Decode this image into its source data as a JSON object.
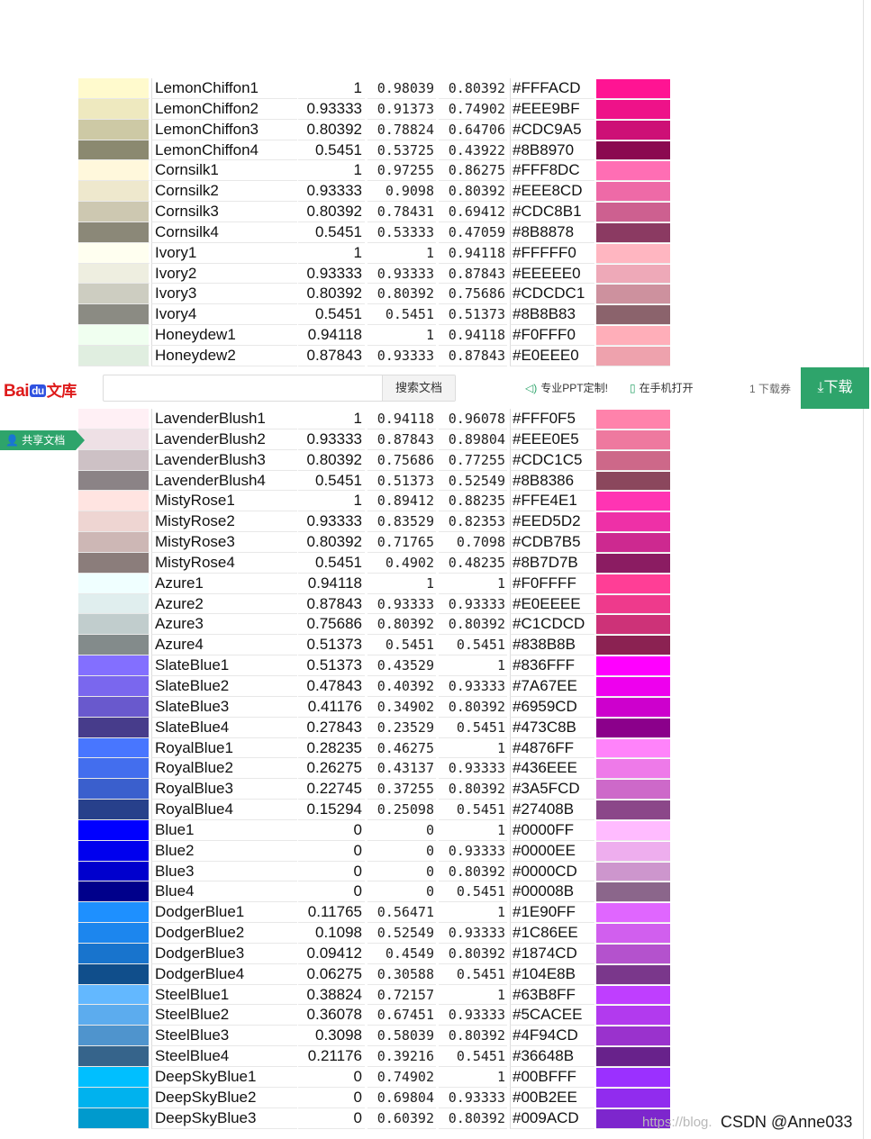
{
  "colors_top": [
    {
      "name": "LemonChiffon1",
      "r": "1",
      "g": "0.98039",
      "b": "0.80392",
      "hex": "#FFFACD",
      "swatch": "#FFFACD",
      "swatch2": "#FF1493"
    },
    {
      "name": "LemonChiffon2",
      "r": "0.93333",
      "g": "0.91373",
      "b": "0.74902",
      "hex": "#EEE9BF",
      "swatch": "#EEE9BF",
      "swatch2": "#EE1289"
    },
    {
      "name": "LemonChiffon3",
      "r": "0.80392",
      "g": "0.78824",
      "b": "0.64706",
      "hex": "#CDC9A5",
      "swatch": "#CDC9A5",
      "swatch2": "#CD1076"
    },
    {
      "name": "LemonChiffon4",
      "r": "0.5451",
      "g": "0.53725",
      "b": "0.43922",
      "hex": "#8B8970",
      "swatch": "#8B8970",
      "swatch2": "#8B0A50"
    },
    {
      "name": "Cornsilk1",
      "r": "1",
      "g": "0.97255",
      "b": "0.86275",
      "hex": "#FFF8DC",
      "swatch": "#FFF8DC",
      "swatch2": "#FF6EB4"
    },
    {
      "name": "Cornsilk2",
      "r": "0.93333",
      "g": "0.9098",
      "b": "0.80392",
      "hex": "#EEE8CD",
      "swatch": "#EEE8CD",
      "swatch2": "#EE6AA7"
    },
    {
      "name": "Cornsilk3",
      "r": "0.80392",
      "g": "0.78431",
      "b": "0.69412",
      "hex": "#CDC8B1",
      "swatch": "#CDC8B1",
      "swatch2": "#CD6090"
    },
    {
      "name": "Cornsilk4",
      "r": "0.5451",
      "g": "0.53333",
      "b": "0.47059",
      "hex": "#8B8878",
      "swatch": "#8B8878",
      "swatch2": "#8B3A62"
    },
    {
      "name": "Ivory1",
      "r": "1",
      "g": "1",
      "b": "0.94118",
      "hex": "#FFFFF0",
      "swatch": "#FFFFF0",
      "swatch2": "#FFB6C1"
    },
    {
      "name": "Ivory2",
      "r": "0.93333",
      "g": "0.93333",
      "b": "0.87843",
      "hex": "#EEEEE0",
      "swatch": "#EEEEE0",
      "swatch2": "#EEA9B8"
    },
    {
      "name": "Ivory3",
      "r": "0.80392",
      "g": "0.80392",
      "b": "0.75686",
      "hex": "#CDCDC1",
      "swatch": "#CDCDC1",
      "swatch2": "#CD919E"
    },
    {
      "name": "Ivory4",
      "r": "0.5451",
      "g": "0.5451",
      "b": "0.51373",
      "hex": "#8B8B83",
      "swatch": "#8B8B83",
      "swatch2": "#8B636C"
    },
    {
      "name": "Honeydew1",
      "r": "0.94118",
      "g": "1",
      "b": "0.94118",
      "hex": "#F0FFF0",
      "swatch": "#F0FFF0",
      "swatch2": "#FFAEB9"
    },
    {
      "name": "Honeydew2",
      "r": "0.87843",
      "g": "0.93333",
      "b": "0.87843",
      "hex": "#E0EEE0",
      "swatch": "#E0EEE0",
      "swatch2": "#EEA2AD"
    }
  ],
  "colors_bottom": [
    {
      "name": "LavenderBlush1",
      "r": "1",
      "g": "0.94118",
      "b": "0.96078",
      "hex": "#FFF0F5",
      "swatch": "#FFF0F5",
      "swatch2": "#FF82AB"
    },
    {
      "name": "LavenderBlush2",
      "r": "0.93333",
      "g": "0.87843",
      "b": "0.89804",
      "hex": "#EEE0E5",
      "swatch": "#EEE0E5",
      "swatch2": "#EE799F"
    },
    {
      "name": "LavenderBlush3",
      "r": "0.80392",
      "g": "0.75686",
      "b": "0.77255",
      "hex": "#CDC1C5",
      "swatch": "#CDC1C5",
      "swatch2": "#CD6889"
    },
    {
      "name": "LavenderBlush4",
      "r": "0.5451",
      "g": "0.51373",
      "b": "0.52549",
      "hex": "#8B8386",
      "swatch": "#8B8386",
      "swatch2": "#8B475D"
    },
    {
      "name": "MistyRose1",
      "r": "1",
      "g": "0.89412",
      "b": "0.88235",
      "hex": "#FFE4E1",
      "swatch": "#FFE4E1",
      "swatch2": "#FF34B3"
    },
    {
      "name": "MistyRose2",
      "r": "0.93333",
      "g": "0.83529",
      "b": "0.82353",
      "hex": "#EED5D2",
      "swatch": "#EED5D2",
      "swatch2": "#EE30A7"
    },
    {
      "name": "MistyRose3",
      "r": "0.80392",
      "g": "0.71765",
      "b": "0.7098",
      "hex": "#CDB7B5",
      "swatch": "#CDB7B5",
      "swatch2": "#CD2990"
    },
    {
      "name": "MistyRose4",
      "r": "0.5451",
      "g": "0.4902",
      "b": "0.48235",
      "hex": "#8B7D7B",
      "swatch": "#8B7D7B",
      "swatch2": "#8B1C62"
    },
    {
      "name": "Azure1",
      "r": "0.94118",
      "g": "1",
      "b": "1",
      "hex": "#F0FFFF",
      "swatch": "#F0FFFF",
      "swatch2": "#FF3E96"
    },
    {
      "name": "Azure2",
      "r": "0.87843",
      "g": "0.93333",
      "b": "0.93333",
      "hex": "#E0EEEE",
      "swatch": "#E0EEEE",
      "swatch2": "#EE3A8C"
    },
    {
      "name": "Azure3",
      "r": "0.75686",
      "g": "0.80392",
      "b": "0.80392",
      "hex": "#C1CDCD",
      "swatch": "#C1CDCD",
      "swatch2": "#CD3278"
    },
    {
      "name": "Azure4",
      "r": "0.51373",
      "g": "0.5451",
      "b": "0.5451",
      "hex": "#838B8B",
      "swatch": "#838B8B",
      "swatch2": "#8B2252"
    },
    {
      "name": "SlateBlue1",
      "r": "0.51373",
      "g": "0.43529",
      "b": "1",
      "hex": "#836FFF",
      "swatch": "#836FFF",
      "swatch2": "#FF00FF"
    },
    {
      "name": "SlateBlue2",
      "r": "0.47843",
      "g": "0.40392",
      "b": "0.93333",
      "hex": "#7A67EE",
      "swatch": "#7A67EE",
      "swatch2": "#EE00EE"
    },
    {
      "name": "SlateBlue3",
      "r": "0.41176",
      "g": "0.34902",
      "b": "0.80392",
      "hex": "#6959CD",
      "swatch": "#6959CD",
      "swatch2": "#CD00CD"
    },
    {
      "name": "SlateBlue4",
      "r": "0.27843",
      "g": "0.23529",
      "b": "0.5451",
      "hex": "#473C8B",
      "swatch": "#473C8B",
      "swatch2": "#8B008B"
    },
    {
      "name": "RoyalBlue1",
      "r": "0.28235",
      "g": "0.46275",
      "b": "1",
      "hex": "#4876FF",
      "swatch": "#4876FF",
      "swatch2": "#FF83FA"
    },
    {
      "name": "RoyalBlue2",
      "r": "0.26275",
      "g": "0.43137",
      "b": "0.93333",
      "hex": "#436EEE",
      "swatch": "#436EEE",
      "swatch2": "#EE7AE9"
    },
    {
      "name": "RoyalBlue3",
      "r": "0.22745",
      "g": "0.37255",
      "b": "0.80392",
      "hex": "#3A5FCD",
      "swatch": "#3A5FCD",
      "swatch2": "#CD69C9"
    },
    {
      "name": "RoyalBlue4",
      "r": "0.15294",
      "g": "0.25098",
      "b": "0.5451",
      "hex": "#27408B",
      "swatch": "#27408B",
      "swatch2": "#8B4789"
    },
    {
      "name": "Blue1",
      "r": "0",
      "g": "0",
      "b": "1",
      "hex": "#0000FF",
      "swatch": "#0000FF",
      "swatch2": "#FFBBFF"
    },
    {
      "name": "Blue2",
      "r": "0",
      "g": "0",
      "b": "0.93333",
      "hex": "#0000EE",
      "swatch": "#0000EE",
      "swatch2": "#EEAEEE"
    },
    {
      "name": "Blue3",
      "r": "0",
      "g": "0",
      "b": "0.80392",
      "hex": "#0000CD",
      "swatch": "#0000CD",
      "swatch2": "#CD96CD"
    },
    {
      "name": "Blue4",
      "r": "0",
      "g": "0",
      "b": "0.5451",
      "hex": "#00008B",
      "swatch": "#00008B",
      "swatch2": "#8B668B"
    },
    {
      "name": "DodgerBlue1",
      "r": "0.11765",
      "g": "0.56471",
      "b": "1",
      "hex": "#1E90FF",
      "swatch": "#1E90FF",
      "swatch2": "#E066FF"
    },
    {
      "name": "DodgerBlue2",
      "r": "0.1098",
      "g": "0.52549",
      "b": "0.93333",
      "hex": "#1C86EE",
      "swatch": "#1C86EE",
      "swatch2": "#D15FEE"
    },
    {
      "name": "DodgerBlue3",
      "r": "0.09412",
      "g": "0.4549",
      "b": "0.80392",
      "hex": "#1874CD",
      "swatch": "#1874CD",
      "swatch2": "#B452CD"
    },
    {
      "name": "DodgerBlue4",
      "r": "0.06275",
      "g": "0.30588",
      "b": "0.5451",
      "hex": "#104E8B",
      "swatch": "#104E8B",
      "swatch2": "#7A378B"
    },
    {
      "name": "SteelBlue1",
      "r": "0.38824",
      "g": "0.72157",
      "b": "1",
      "hex": "#63B8FF",
      "swatch": "#63B8FF",
      "swatch2": "#BF3EFF"
    },
    {
      "name": "SteelBlue2",
      "r": "0.36078",
      "g": "0.67451",
      "b": "0.93333",
      "hex": "#5CACEE",
      "swatch": "#5CACEE",
      "swatch2": "#B23AEE"
    },
    {
      "name": "SteelBlue3",
      "r": "0.3098",
      "g": "0.58039",
      "b": "0.80392",
      "hex": "#4F94CD",
      "swatch": "#4F94CD",
      "swatch2": "#9A32CD"
    },
    {
      "name": "SteelBlue4",
      "r": "0.21176",
      "g": "0.39216",
      "b": "0.5451",
      "hex": "#36648B",
      "swatch": "#36648B",
      "swatch2": "#68228B"
    },
    {
      "name": "DeepSkyBlue1",
      "r": "0",
      "g": "0.74902",
      "b": "1",
      "hex": "#00BFFF",
      "swatch": "#00BFFF",
      "swatch2": "#9B30FF"
    },
    {
      "name": "DeepSkyBlue2",
      "r": "0",
      "g": "0.69804",
      "b": "0.93333",
      "hex": "#00B2EE",
      "swatch": "#00B2EE",
      "swatch2": "#912CEE"
    },
    {
      "name": "DeepSkyBlue3",
      "r": "0",
      "g": "0.60392",
      "b": "0.80392",
      "hex": "#009ACD",
      "swatch": "#009ACD",
      "swatch2": "#7D26CD"
    }
  ],
  "baidu_bar": {
    "logo_bai": "Bai",
    "logo_du": "du",
    "logo_wenku": "文库",
    "search_placeholder": "",
    "search_button": "搜索文档",
    "promo": "专业PPT定制!",
    "mobile": "在手机打开",
    "download_count": "1 下载券",
    "download_button": "下载"
  },
  "share_tag": "共享文档",
  "watermark": "CSDN @Anne033",
  "watermark_faint": "https://blog.",
  "icons": {
    "speaker": "speaker-icon",
    "phone": "phone-icon",
    "download": "download-icon",
    "user": "user-icon"
  }
}
